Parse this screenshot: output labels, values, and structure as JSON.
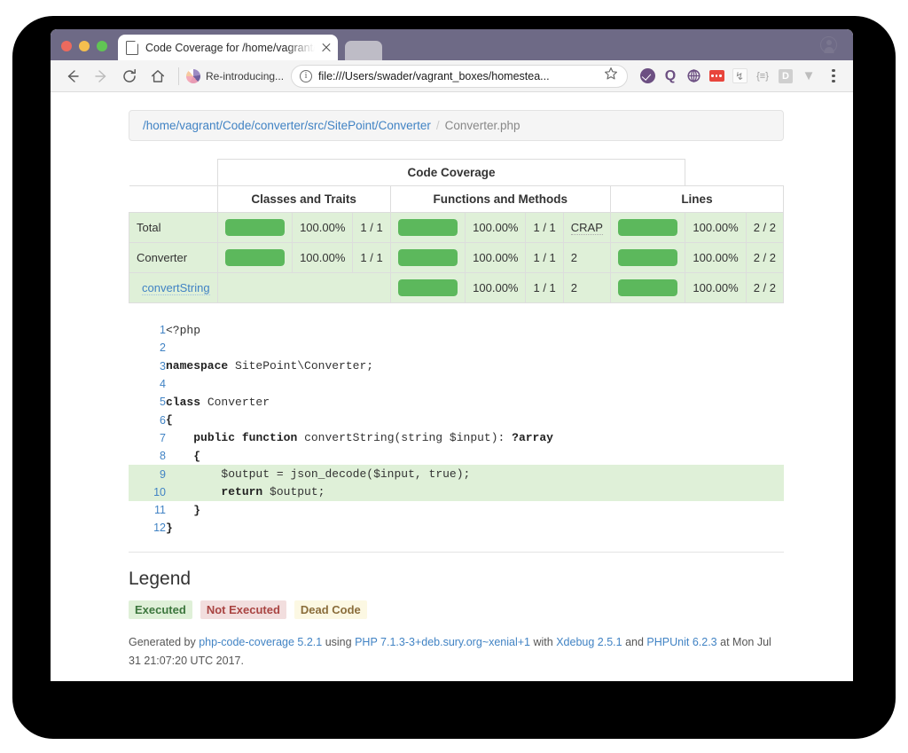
{
  "window": {
    "traffic_lights": [
      "close",
      "minimize",
      "maximize"
    ],
    "tab_title": "Code Coverage for /home/vagrant/C",
    "profile_icon": "user-avatar-icon"
  },
  "toolbar": {
    "back_icon": "back-arrow-icon",
    "forward_icon": "forward-arrow-icon",
    "reload_icon": "reload-icon",
    "home_icon": "home-icon",
    "bookmark_label": "Re-introducing...",
    "bookmark_favicon": "sitepoint-swirl-icon",
    "omnibox_url": "file:///Users/swader/vagrant_boxes/homestea...",
    "omnibox_info_icon": "page-info-icon",
    "star_icon": "bookmark-star-icon",
    "extensions": [
      {
        "name": "check-circle-extension-icon",
        "type": "purple-check"
      },
      {
        "name": "q-extension-icon",
        "type": "q",
        "label": "Q"
      },
      {
        "name": "globe-extension-icon",
        "type": "globe"
      },
      {
        "name": "red-dots-extension-icon",
        "type": "red"
      },
      {
        "name": "flash-extension-icon",
        "type": "flash",
        "label": "↯"
      },
      {
        "name": "braces-extension-icon",
        "type": "brace",
        "label": "{≡}"
      },
      {
        "name": "d-extension-icon",
        "type": "d",
        "label": "D"
      },
      {
        "name": "v-extension-icon",
        "type": "v",
        "label": "▼"
      }
    ],
    "menu_icon": "kebab-menu-icon"
  },
  "breadcrumb": {
    "path_link": "/home/vagrant/Code/converter/src/SitePoint/Converter",
    "separator": "/",
    "current": "Converter.php"
  },
  "coverage_table": {
    "group_header": "Code Coverage",
    "column_groups": [
      "Classes and Traits",
      "Functions and Methods",
      "Lines"
    ],
    "rows": [
      {
        "name": "Total",
        "is_link": false,
        "classes": {
          "show_bar": true,
          "percent_fill": 100,
          "percent": "100.00%",
          "fraction": "1 / 1"
        },
        "functions": {
          "show_bar": true,
          "percent_fill": 100,
          "percent": "100.00%",
          "fraction": "1 / 1",
          "crap": "CRAP",
          "crap_is_abbr": true
        },
        "lines": {
          "show_bar": true,
          "percent_fill": 100,
          "percent": "100.00%",
          "fraction": "2 / 2"
        }
      },
      {
        "name": "Converter",
        "is_link": false,
        "classes": {
          "show_bar": true,
          "percent_fill": 100,
          "percent": "100.00%",
          "fraction": "1 / 1"
        },
        "functions": {
          "show_bar": true,
          "percent_fill": 100,
          "percent": "100.00%",
          "fraction": "1 / 1",
          "crap": "2",
          "crap_is_abbr": false
        },
        "lines": {
          "show_bar": true,
          "percent_fill": 100,
          "percent": "100.00%",
          "fraction": "2 / 2"
        }
      },
      {
        "name": "convertString",
        "is_link": true,
        "classes": {
          "show_bar": false,
          "percent_fill": 0,
          "percent": "",
          "fraction": ""
        },
        "functions": {
          "show_bar": true,
          "percent_fill": 100,
          "percent": "100.00%",
          "fraction": "1 / 1",
          "crap": "2",
          "crap_is_abbr": false
        },
        "lines": {
          "show_bar": true,
          "percent_fill": 100,
          "percent": "100.00%",
          "fraction": "2 / 2"
        }
      }
    ]
  },
  "source": {
    "lines": [
      {
        "n": "1",
        "text": "<?php",
        "executed": false,
        "bold_prefix": ""
      },
      {
        "n": "2",
        "text": "",
        "executed": false,
        "bold_prefix": ""
      },
      {
        "n": "3",
        "text": "namespace SitePoint\\Converter;",
        "executed": false,
        "bold_prefix": "namespace"
      },
      {
        "n": "4",
        "text": "",
        "executed": false,
        "bold_prefix": ""
      },
      {
        "n": "5",
        "text": "class Converter",
        "executed": false,
        "bold_prefix": "class"
      },
      {
        "n": "6",
        "text": "{",
        "executed": false,
        "bold_prefix": "{"
      },
      {
        "n": "7",
        "text": "    public function convertString(string $input): ?array",
        "executed": false,
        "bold_prefix": ""
      },
      {
        "n": "8",
        "text": "    {",
        "executed": false,
        "bold_prefix": ""
      },
      {
        "n": "9",
        "text": "        $output = json_decode($input, true);",
        "executed": true,
        "bold_prefix": ""
      },
      {
        "n": "10",
        "text": "        return $output;",
        "executed": true,
        "bold_prefix": ""
      },
      {
        "n": "11",
        "text": "    }",
        "executed": false,
        "bold_prefix": "}"
      },
      {
        "n": "12",
        "text": "}",
        "executed": false,
        "bold_prefix": "}"
      }
    ]
  },
  "legend": {
    "title": "Legend",
    "items": [
      {
        "label": "Executed",
        "style": "lg-exec"
      },
      {
        "label": "Not Executed",
        "style": "lg-notexec"
      },
      {
        "label": "Dead Code",
        "style": "lg-dead"
      }
    ]
  },
  "footer": {
    "prefix": "Generated by",
    "tool": "php-code-coverage 5.2.1",
    "using": "using",
    "php": "PHP 7.1.3-3+deb.sury.org~xenial+1",
    "with": "with",
    "xdebug": "Xdebug 2.5.1",
    "and": "and",
    "phpunit": "PHPUnit 6.2.3",
    "at": "at",
    "timestamp": "Mon Jul 31 21:07:20 UTC 2017."
  },
  "colors": {
    "titlebar": "#6e6a86",
    "accent_link": "#4183c4",
    "success_bar": "#5cb85c",
    "success_row": "#dff0d8",
    "danger_row": "#f2dede",
    "warning_row": "#fcf8e3"
  }
}
